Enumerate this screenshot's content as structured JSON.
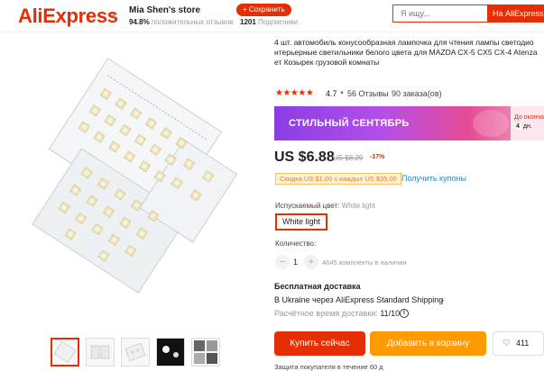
{
  "header": {
    "logo": "AliExpress",
    "store_name": "Mia Shen's store",
    "rating_pct": "94.8%",
    "rating_text": "положительных отзывов",
    "save_label": "+ Сохранить",
    "subscribers_count": "1201",
    "subscribers_text": "Подписчики",
    "search_placeholder": "Я ищу...",
    "search_button": "На AliExpress"
  },
  "product": {
    "title": "4 шт. автомобиль конусообразная лампочка для чтения лампы светодио нтерьерные светильники белого цвета для MAZDA CX-5 CX5 CX-4 Atenza ет Козырек грузовой комнаты",
    "rating_value": "4.7",
    "rating_stars": "★★★★★",
    "reviews": "56 Отзывы",
    "orders": "90 заказа(ов)"
  },
  "banner": {
    "text": "СТИЛЬНЫЙ СЕНТЯБРЬ",
    "side_text": "До оконча",
    "side_days": "4",
    "side_unit": "дн."
  },
  "price": {
    "current": "US $6.88",
    "old": "US $8.29",
    "discount": "-17%",
    "coupon": "Скидка US $1.00 с каждых US $35.00",
    "coupon_link": "Получить купоны"
  },
  "options": {
    "color_label": "Испускаемый цвет:",
    "color_value": "White light",
    "variant": "White light",
    "qty_label": "Количество:",
    "qty_minus": "−",
    "qty_value": "1",
    "qty_plus": "+",
    "qty_stock": "4645 комплекты в наличии"
  },
  "shipping": {
    "title": "Бесплатная доставка",
    "line": "В Ukraine через AliExpress Standard Shipping",
    "time_label": "Расчётное время доставки:",
    "time_value": "11/10",
    "footer": "Защита покупателя в течение 60 д"
  },
  "actions": {
    "buy": "Купить сейчас",
    "cart": "Добавить в корзину",
    "wishlist_count": "411"
  },
  "colors": {
    "brand": "#e62e04",
    "cart": "#ff9a00",
    "link": "#2e86c1"
  }
}
